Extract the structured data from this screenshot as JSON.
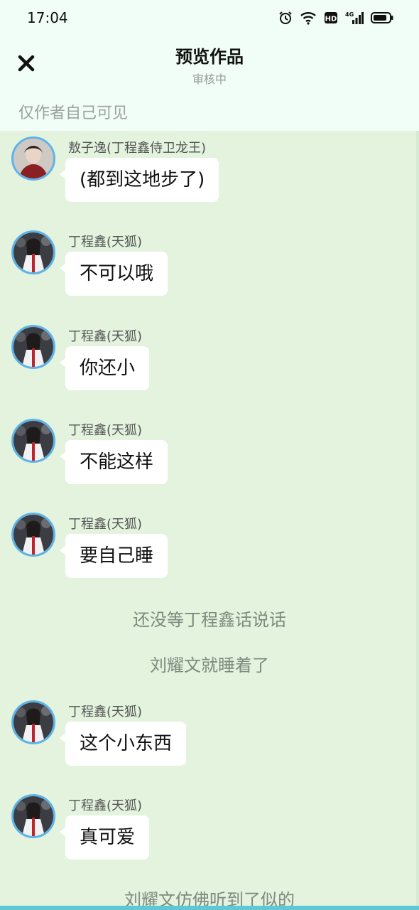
{
  "status_bar": {
    "time": "17:04",
    "icons": [
      "alarm-icon",
      "wifi-icon",
      "hd-icon",
      "signal-4g-icon",
      "battery-icon"
    ],
    "hd_label": "HD",
    "net_label": "4G"
  },
  "header": {
    "close_icon": "close-icon",
    "title": "预览作品",
    "subtitle": "审核中",
    "visibility_note": "仅作者自己可见"
  },
  "messages": [
    {
      "name": "敖子逸(丁程鑫侍卫龙王)",
      "text": "(都到这地步了)"
    },
    {
      "name": "丁程鑫(天狐)",
      "text": "不可以哦"
    },
    {
      "name": "丁程鑫(天狐)",
      "text": "你还小"
    },
    {
      "name": "丁程鑫(天狐)",
      "text": "不能这样"
    },
    {
      "name": "丁程鑫(天狐)",
      "text": "要自己睡"
    }
  ],
  "narrations": [
    "还没等丁程鑫话说话",
    "刘耀文就睡着了"
  ],
  "messages2": [
    {
      "name": "丁程鑫(天狐)",
      "text": "这个小东西"
    },
    {
      "name": "丁程鑫(天狐)",
      "text": "真可爱"
    }
  ],
  "narration_bottom": "刘耀文仿佛听到了似的",
  "colors": {
    "background": "#e3f3de",
    "header_bg": "#f1fdf7",
    "avatar_ring": "#5db3e8",
    "bubble": "#ffffff",
    "bottom_bar": "#5ec8d8"
  }
}
